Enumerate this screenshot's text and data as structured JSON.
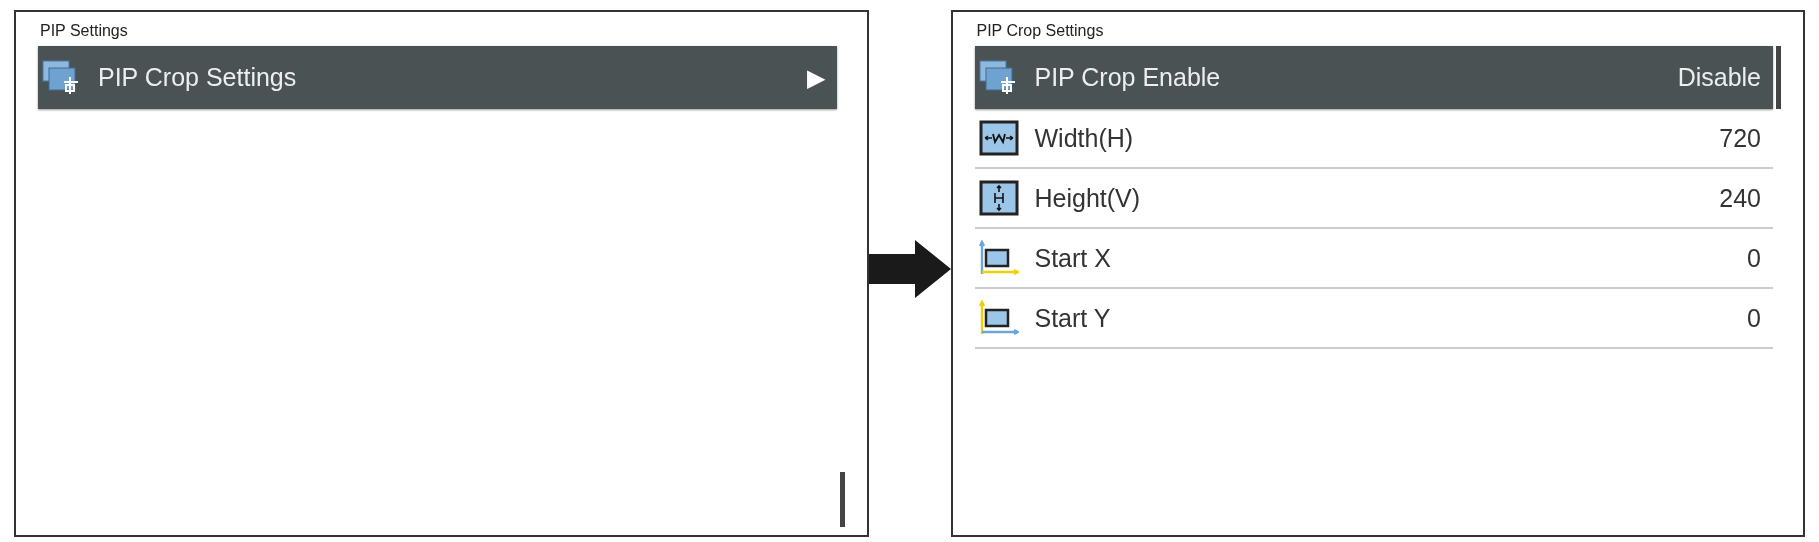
{
  "screens": [
    {
      "title": "PIP Settings",
      "items": [
        {
          "label": "PIP Crop Settings",
          "selected": true,
          "kind": "submenu",
          "arrow": "▶"
        }
      ]
    },
    {
      "title": "PIP Crop Settings",
      "items": [
        {
          "label": "PIP Crop Enable",
          "selected": true,
          "kind": "value",
          "value": "Disable"
        },
        {
          "label": "Width(H)",
          "selected": false,
          "kind": "value",
          "value": "720"
        },
        {
          "label": "Height(V)",
          "selected": false,
          "kind": "value",
          "value": "240"
        },
        {
          "label": "Start  X",
          "selected": false,
          "kind": "value",
          "value": "0"
        },
        {
          "label": "Start  Y",
          "selected": false,
          "kind": "value",
          "value": "0"
        }
      ]
    }
  ]
}
